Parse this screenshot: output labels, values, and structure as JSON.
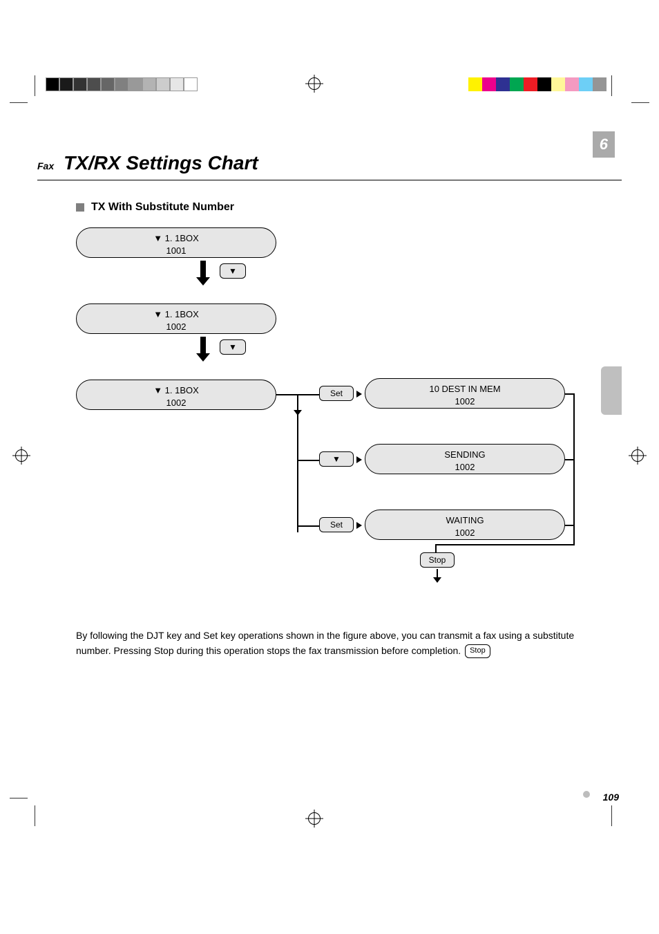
{
  "chapter": {
    "number": "6",
    "side_label": "Fax",
    "title": "TX/RX Settings Chart"
  },
  "subsection": "TX With Substitute Number",
  "flow": {
    "stage1": {
      "line1": "▼ 1. 1BOX",
      "line2": "1001"
    },
    "stage2": {
      "line1": "▼ 1. 1BOX",
      "line2": "1002"
    },
    "stage3": {
      "line1": "▼ 1. 1BOX",
      "line2": "1002"
    },
    "key_down1": "▼",
    "key_down2": "▼",
    "key_downA": "▼",
    "key_setA": "Set",
    "key_setB": "Set",
    "key_stop": "Stop",
    "branch1": {
      "line1": "10 DEST IN MEM",
      "line2": "1002"
    },
    "branch2": {
      "line1": "SENDING",
      "line2": "1002"
    },
    "branch3": {
      "line1": "WAITING",
      "line2": "1002"
    }
  },
  "paragraph": "By following the DJT key and Set key operations shown in the figure above, you can transmit a fax using a substitute number. Pressing Stop during this operation stops the fax transmission before completion.",
  "page_number": "109",
  "stop_inline": "Stop"
}
